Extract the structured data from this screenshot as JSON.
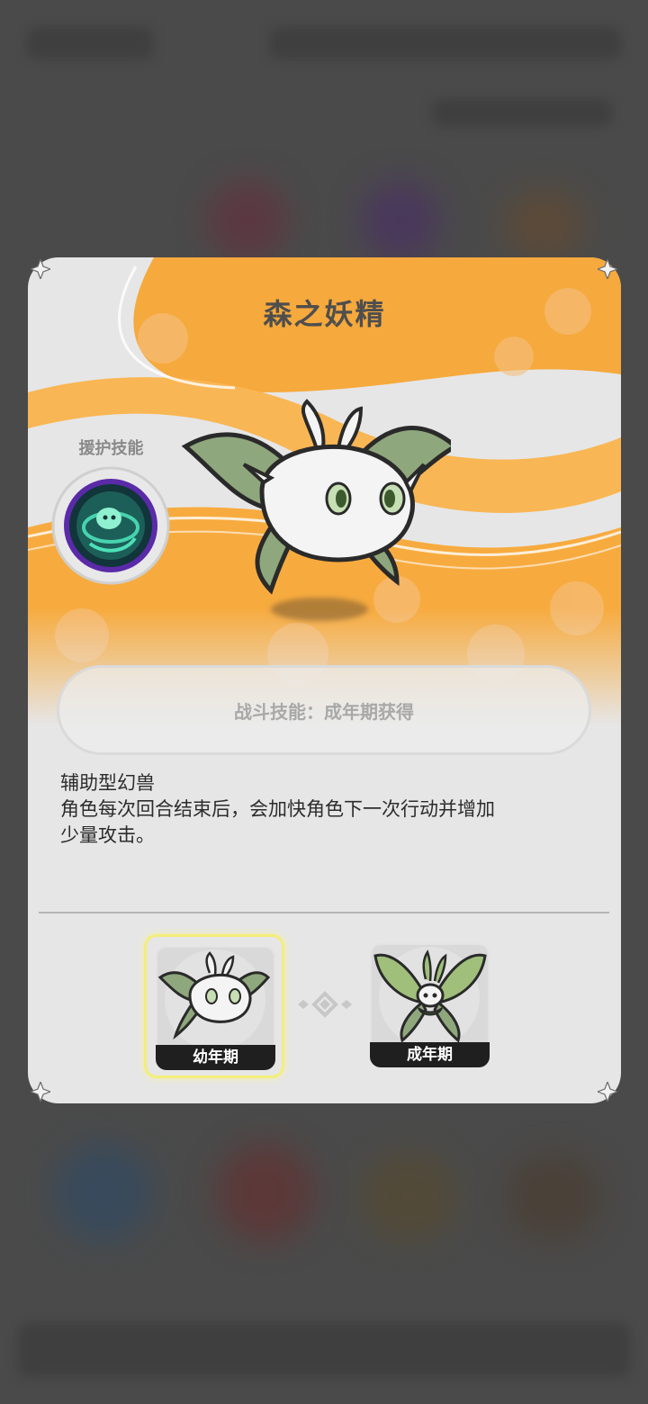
{
  "modal": {
    "title": "森之妖精",
    "support_skill_label": "援护技能",
    "combat_skill_text": "战斗技能：成年期获得",
    "description": {
      "type_line": "辅助型幻兽",
      "effect_line_1": "角色每次回合结束后，会加快角色下一次行动并增加",
      "effect_line_2": "少量攻击。"
    },
    "stages": [
      {
        "label": "幼年期",
        "selected": true
      },
      {
        "label": "成年期",
        "selected": false
      }
    ]
  },
  "colors": {
    "accent_orange": "#f7a83a",
    "panel_bg": "#e6e6e6",
    "selected_border": "#f3ee7a",
    "skill_ring": "#7a3fd0",
    "skill_glow": "#34c9a0"
  },
  "icons": {
    "support_skill": "green-vortex-skill-icon",
    "creature": "forest-fairy-creature",
    "corner": "corner-ornament-icon",
    "connector": "diamond-connector-icon"
  }
}
